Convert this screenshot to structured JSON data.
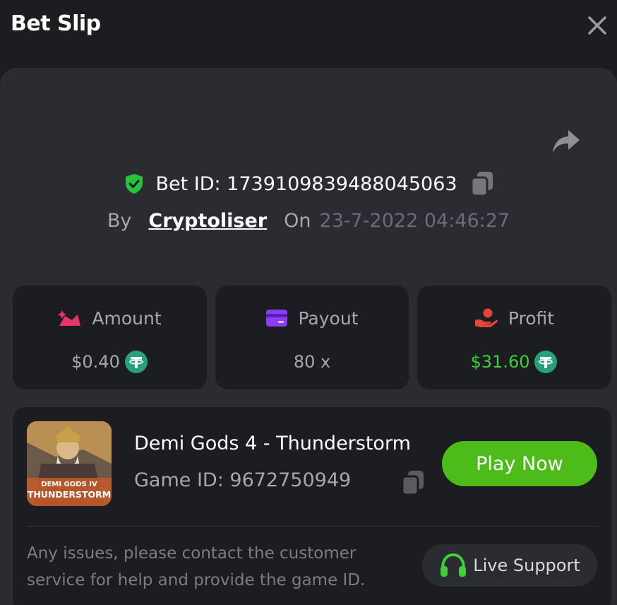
{
  "header": {
    "title": "Bet Slip"
  },
  "bet": {
    "id_text": "Bet ID: 17391098394880450​63",
    "by_label": "By",
    "username": "Cryptoliser",
    "on_label": "On",
    "datetime": "23-7-2022 04:46:27"
  },
  "stats": [
    {
      "label": "Amount",
      "value": "$0.40",
      "icon": "amount-icon",
      "icon_color": "#e8336b",
      "show_coin": true
    },
    {
      "label": "Payout",
      "value": "80 x",
      "icon": "card-icon",
      "icon_color": "#8b3cf7",
      "show_coin": false
    },
    {
      "label": "Profit",
      "value": "$31.60",
      "icon": "hand-coin-icon",
      "icon_color": "#e8423a",
      "show_coin": true
    }
  ],
  "game": {
    "title": "Demi Gods 4 - Thunderstorm",
    "id_text": "Game ID: 9672750949",
    "thumb_line1": "DEMI GODS IV",
    "thumb_line2": "THUNDERSTORM",
    "play_label": "Play Now"
  },
  "support": {
    "help_text": "Any issues, please contact the customer service for help and provide the game ID.",
    "button_label": "Live Support"
  },
  "colors": {
    "accent_green": "#4dbb1a",
    "profit_green": "#3fcf37",
    "coin_teal": "#26a17b",
    "shield_green": "#27c13a"
  }
}
